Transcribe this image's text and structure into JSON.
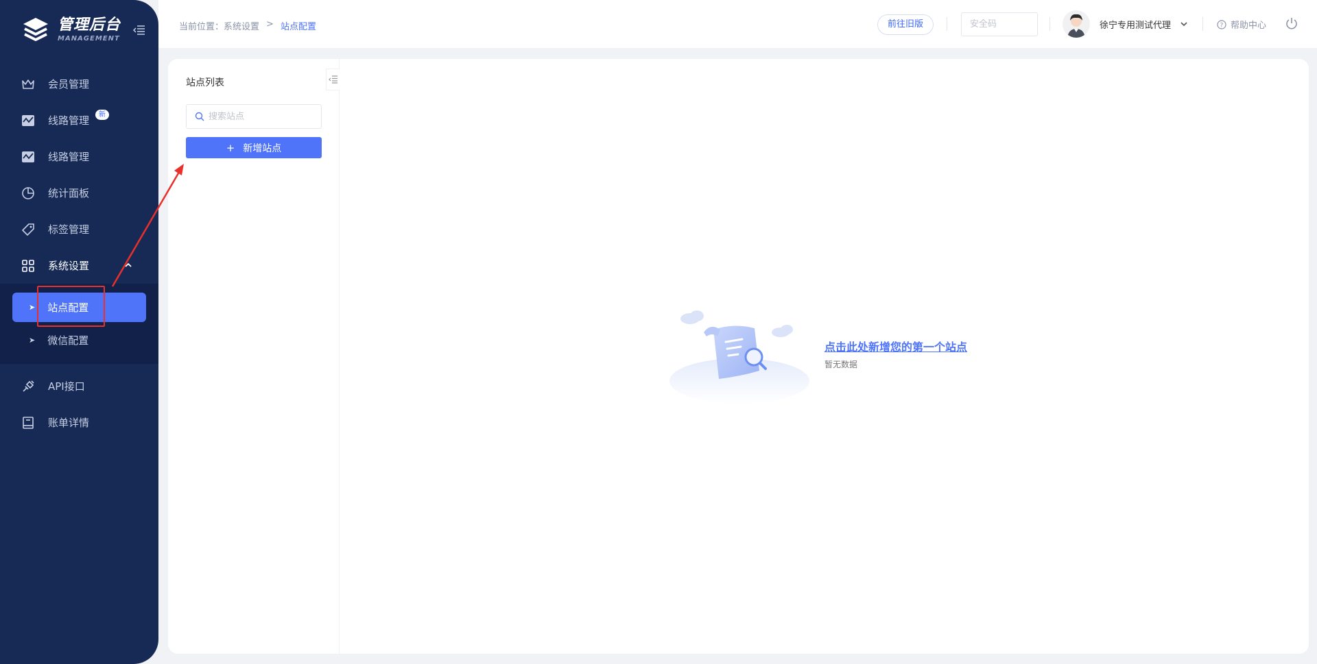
{
  "sidebar": {
    "logo_title": "管理后台",
    "logo_sub": "MANAGEMENT",
    "items": [
      {
        "label": "会员管理",
        "icon": "crown-icon"
      },
      {
        "label": "线路管理",
        "icon": "line-chart-icon",
        "badge": "新"
      },
      {
        "label": "线路管理",
        "icon": "line-chart-icon"
      },
      {
        "label": "统计面板",
        "icon": "pie-chart-icon"
      },
      {
        "label": "标签管理",
        "icon": "tag-icon"
      },
      {
        "label": "系统设置",
        "icon": "grid-icon",
        "expanded": true
      }
    ],
    "submenu": [
      {
        "label": "站点配置",
        "active": true
      },
      {
        "label": "微信配置",
        "active": false
      }
    ],
    "bottom_items": [
      {
        "label": "API接口",
        "icon": "plug-icon"
      },
      {
        "label": "账单详情",
        "icon": "book-icon"
      }
    ]
  },
  "topbar": {
    "crumb_prefix": "当前位置：",
    "crumb_parent": "系统设置",
    "crumb_sep": ">",
    "crumb_current": "站点配置",
    "old_version_btn": "前往旧版",
    "security_placeholder": "安全码",
    "username": "徐宁专用测试代理",
    "help": "帮助中心"
  },
  "site_panel": {
    "title": "站点列表",
    "search_placeholder": "搜索站点",
    "add_button": "新增站点"
  },
  "empty_state": {
    "link": "点击此处新增您的第一个站点",
    "sub": "暂无数据"
  },
  "colors": {
    "sidebar_bg": "#172a55",
    "accent": "#4f74f9",
    "annotation": "#e8302c"
  }
}
